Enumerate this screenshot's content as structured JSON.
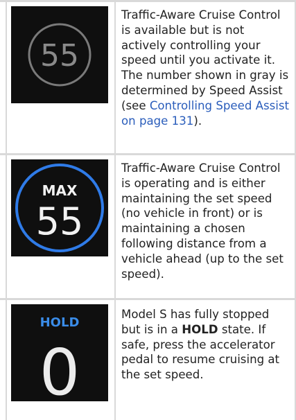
{
  "rows": [
    {
      "icon": {
        "name": "speed-gray-icon",
        "speed": "55",
        "ring_color": "#7a7a7a",
        "text_color": "#8a8a8a"
      },
      "text_before": "Traffic-Aware Cruise Control is available but is not actively controlling your speed until you activate it. The number shown in gray is determined by Speed Assist (see ",
      "link": "Controlling Speed Assist on page 131",
      "text_after": ")."
    },
    {
      "icon": {
        "name": "max-speed-icon",
        "label": "MAX",
        "speed": "55",
        "ring_color": "#2f7be8",
        "text_color": "#f2f2f2"
      },
      "text": "Traffic-Aware Cruise Control is operating and is either maintaining the set speed (no vehicle in front) or is maintaining a chosen following distance from a vehicle ahead (up to the set speed)."
    },
    {
      "icon": {
        "name": "hold-icon",
        "label": "HOLD",
        "speed": "0",
        "label_color": "#3a8ce8",
        "text_color": "#ececec"
      },
      "text_before": "Model S has fully stopped but is in a ",
      "bold": "HOLD",
      "text_after": " state. If safe, press the accelerator pedal to resume cruising at the set speed."
    }
  ]
}
